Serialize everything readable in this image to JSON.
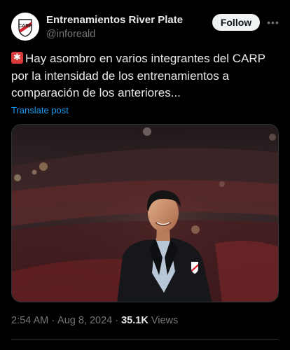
{
  "account": {
    "display_name": "Entrenamientos River Plate",
    "handle": "@inforeald",
    "avatar_icon": "river-plate-crest-icon"
  },
  "header": {
    "follow_label": "Follow",
    "more_icon": "more-options-icon"
  },
  "post": {
    "emoji_icon": "siren-icon",
    "text": "Hay asombro en varios integrantes del CARP por la intensidad de los entrenamientos a comparación de los anteriores...",
    "translate_label": "Translate post",
    "media_description_icon": "photo-coach-stadium"
  },
  "meta": {
    "time": "2:54 AM",
    "separator": "·",
    "date": "Aug 8, 2024",
    "views_count": "35.1K",
    "views_label": "Views"
  },
  "colors": {
    "background": "#000000",
    "text": "#e7e9ea",
    "muted": "#71767b",
    "link": "#1d9bf0",
    "river_red": "#d4202c"
  }
}
